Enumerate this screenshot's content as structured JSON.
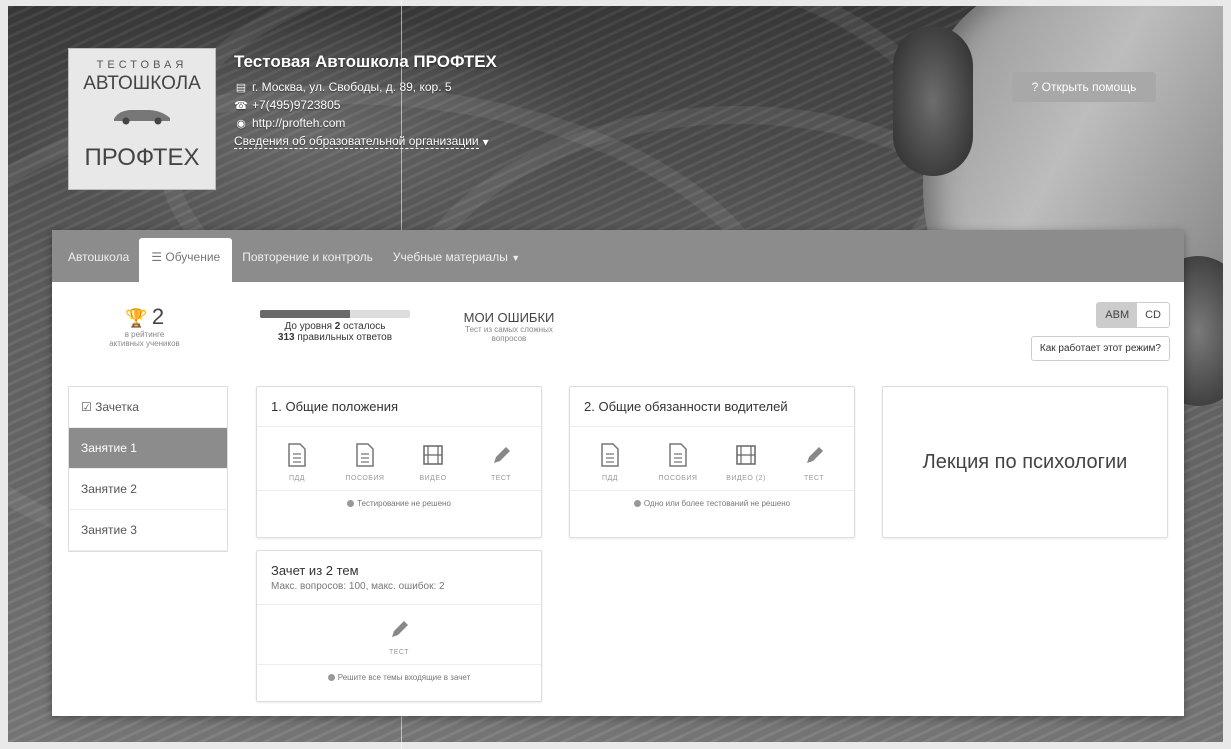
{
  "header": {
    "logo": {
      "line1": "ТЕСТОВАЯ",
      "line2": "АВТОШКОЛА",
      "line3": "ПРОФТЕХ"
    },
    "school_name": "Тестовая Автошкола ПРОФТЕХ",
    "address": "г. Москва, ул. Свободы, д. 89, кор. 5",
    "phone": "+7(495)9723805",
    "website": "http://profteh.com",
    "info_link": "Сведения об образовательной организации",
    "help_button": "? Открыть помощь"
  },
  "nav": {
    "items": [
      {
        "label": "Автошкола"
      },
      {
        "label": "Обучение"
      },
      {
        "label": "Повторение и контроль"
      },
      {
        "label": "Учебные материалы"
      }
    ]
  },
  "stats": {
    "rank_value": "2",
    "rank_sub1": "в рейтинге",
    "rank_sub2": "активных учеников",
    "level_line1_pre": "До уровня ",
    "level_line1_num": "2",
    "level_line1_post": " осталось",
    "level_line2_num": "313",
    "level_line2_post": " правильных ответов",
    "level_progress": 0.6,
    "mistakes_title": "МОИ ОШИБКИ",
    "mistakes_sub1": "Тест из самых сложных",
    "mistakes_sub2": "вопросов"
  },
  "mode": {
    "options": [
      "ABM",
      "CD"
    ],
    "selected": "ABM",
    "how_button": "Как работает этот режим?"
  },
  "sidebar": {
    "items": [
      {
        "label": "Зачетка"
      },
      {
        "label": "Занятие 1"
      },
      {
        "label": "Занятие 2"
      },
      {
        "label": "Занятие 3"
      }
    ]
  },
  "cards": [
    {
      "title": "1. Общие положения",
      "tools": [
        "ПДД",
        "ПОСОБИЯ",
        "ВИДЕО",
        "ТЕСТ"
      ],
      "footer": "Тестирование не решено"
    },
    {
      "title": "2. Общие обязанности водителей",
      "tools": [
        "ПДД",
        "ПОСОБИЯ",
        "ВИДЕО (2)",
        "ТЕСТ"
      ],
      "footer": "Одно или более тестований не решено"
    }
  ],
  "lecture": {
    "title": "Лекция по психологии"
  },
  "exam": {
    "title": "Зачет из 2 тем",
    "subtitle": "Макс. вопросов: 100, макс. ошибок: 2",
    "tool": "ТЕСТ",
    "footer": "Решите все темы входящие в зачет"
  }
}
